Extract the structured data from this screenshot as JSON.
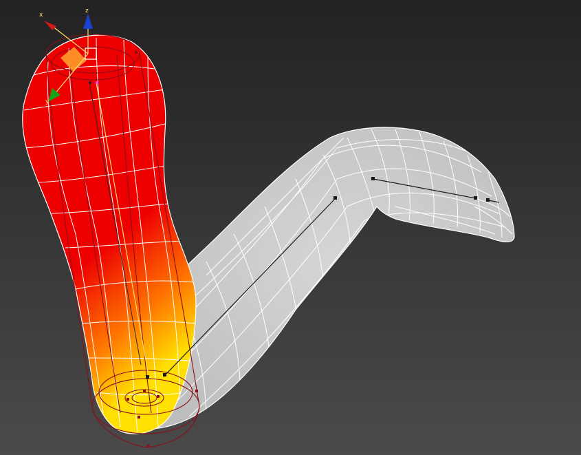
{
  "viewport": {
    "background_top": "#222222",
    "background_bottom": "#4a4a4a"
  },
  "gizmo": {
    "x_label": "x",
    "y_label": "y",
    "z_label": "z",
    "x_color": "#d11a1a",
    "y_color": "#1aa11a",
    "z_color": "#1a3fd1",
    "label_color": "#ffe06a"
  },
  "mesh": {
    "skin_color": "#cfcfcf",
    "wire_color": "#ffffff",
    "weight_high": "#ee0000",
    "weight_mid": "#ff7700",
    "weight_low": "#ffe000"
  },
  "bones": {
    "color": "#1a1a1a",
    "envelope_color": "#8a0f18"
  }
}
